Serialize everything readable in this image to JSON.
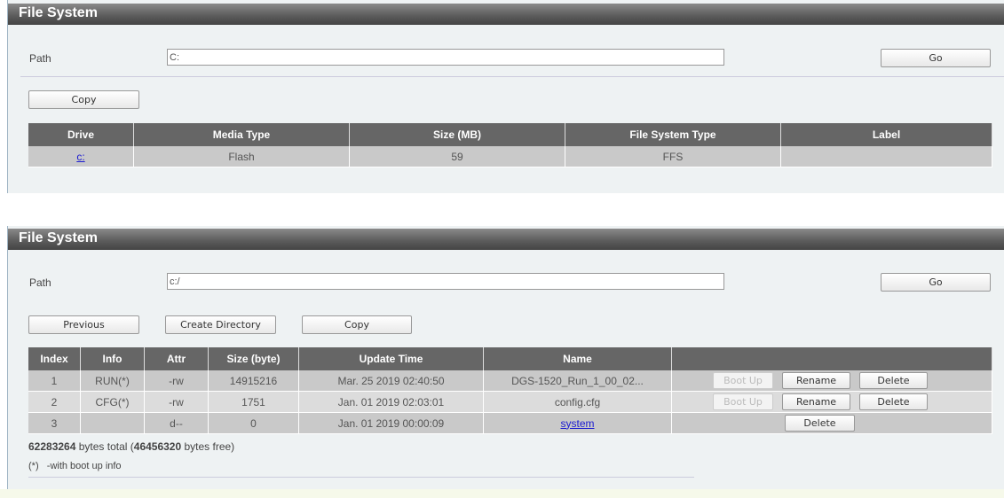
{
  "panel1": {
    "title": "File System",
    "path_label": "Path",
    "path_value": "C:",
    "go": "Go",
    "copy": "Copy",
    "headers": [
      "Drive",
      "Media Type",
      "Size (MB)",
      "File System Type",
      "Label"
    ],
    "rows": [
      {
        "drive": "c:",
        "media": "Flash",
        "size": "59",
        "fstype": "FFS",
        "label": ""
      }
    ]
  },
  "panel2": {
    "title": "File System",
    "path_label": "Path",
    "path_value": "c:/",
    "go": "Go",
    "previous": "Previous",
    "create_directory": "Create Directory",
    "copy": "Copy",
    "headers": [
      "Index",
      "Info",
      "Attr",
      "Size (byte)",
      "Update Time",
      "Name",
      ""
    ],
    "rows": [
      {
        "index": "1",
        "info": "RUN(*)",
        "attr": "-rw",
        "size": "14915216",
        "time": "Mar. 25 2019 02:40:50",
        "name": "DGS-1520_Run_1_00_02...",
        "bootup": "Boot Up",
        "rename": "Rename",
        "delete": "Delete"
      },
      {
        "index": "2",
        "info": "CFG(*)",
        "attr": "-rw",
        "size": "1751",
        "time": "Jan. 01 2019 02:03:01",
        "name": "config.cfg",
        "bootup": "Boot Up",
        "rename": "Rename",
        "delete": "Delete"
      },
      {
        "index": "3",
        "info": "",
        "attr": "d--",
        "size": "0",
        "time": "Jan. 01 2019 00:00:09",
        "name": "system",
        "delete": "Delete"
      }
    ],
    "total_bytes": "62283264",
    "total_text": " bytes total (",
    "free_bytes": "46456320",
    "free_text": " bytes free)",
    "note_mark": "(*)",
    "note_text": "-with boot up info"
  }
}
